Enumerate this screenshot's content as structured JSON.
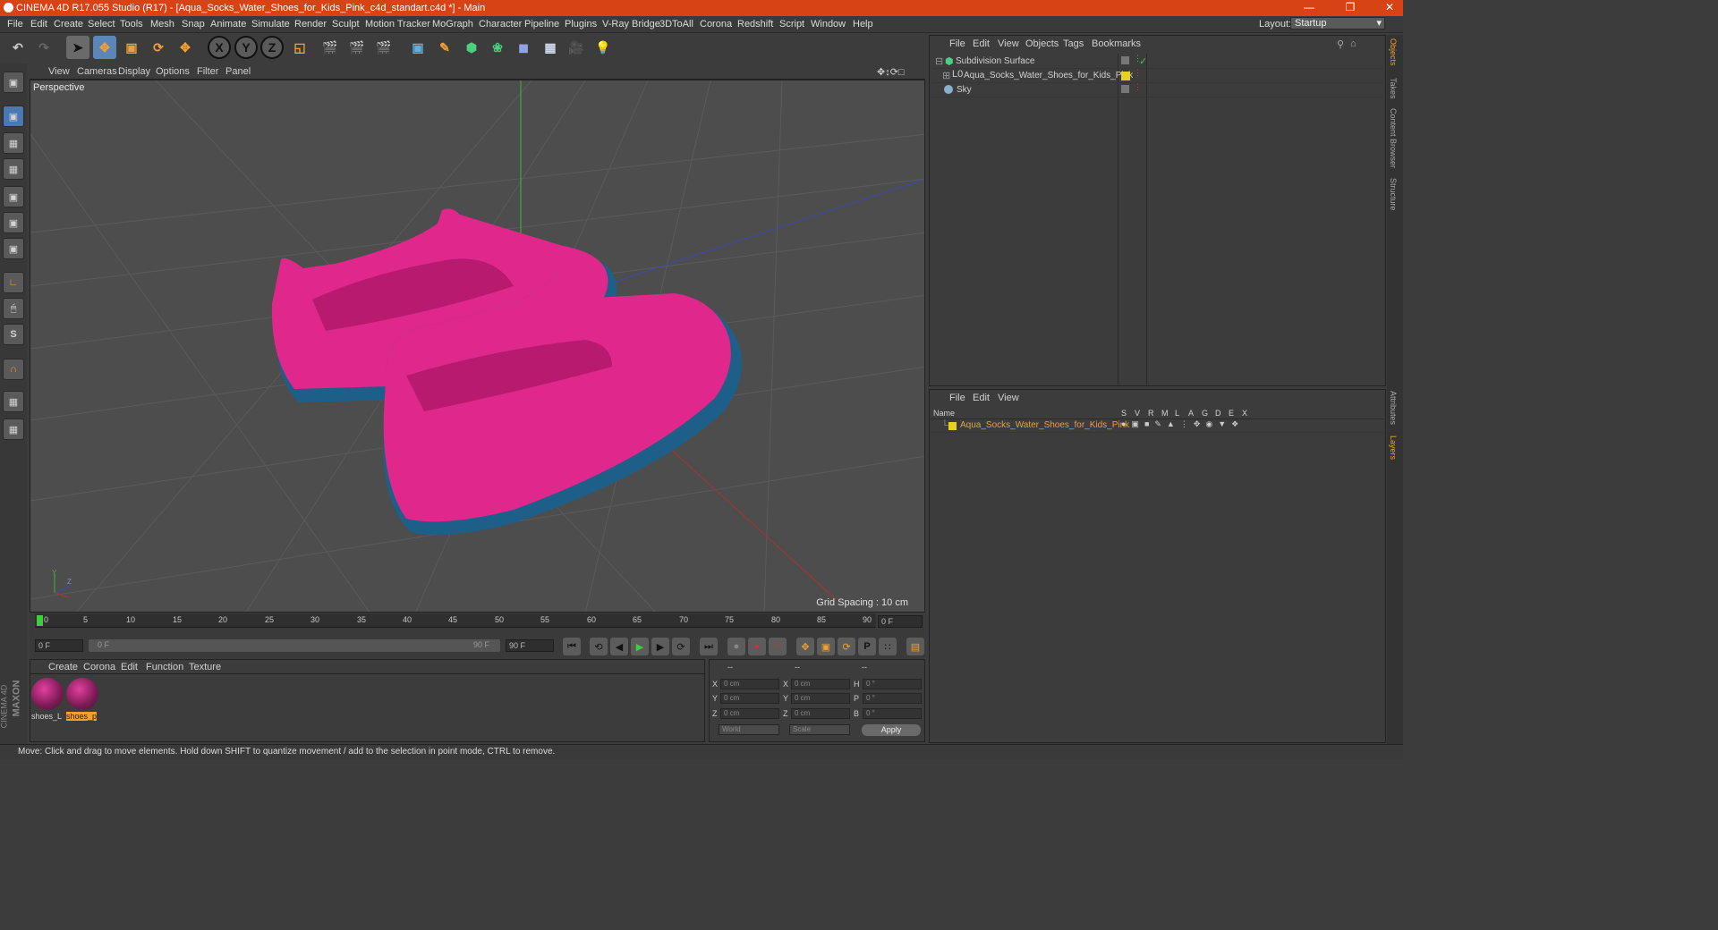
{
  "window": {
    "title": "CINEMA 4D R17.055 Studio (R17) - [Aqua_Socks_Water_Shoes_for_Kids_Pink_c4d_standart.c4d *] - Main",
    "minimize": "—",
    "restore": "❐",
    "close": "✕"
  },
  "menu": [
    "File",
    "Edit",
    "Create",
    "Select",
    "Tools",
    "Mesh",
    "Snap",
    "Animate",
    "Simulate",
    "Render",
    "Sculpt",
    "Motion Tracker",
    "MoGraph",
    "Character",
    "Pipeline",
    "Plugins",
    "V-Ray Bridge",
    "3DToAll",
    "Corona",
    "Redshift",
    "Script",
    "Window",
    "Help"
  ],
  "layout": {
    "label": "Layout:",
    "value": "Startup"
  },
  "toolbar": {
    "x": "X",
    "y": "Y",
    "z": "Z"
  },
  "viewport": {
    "menu": [
      "View",
      "Cameras",
      "Display",
      "Options",
      "Filter",
      "Panel"
    ],
    "label": "Perspective",
    "grid_spacing": "Grid Spacing : 10 cm",
    "axis_y": "Y",
    "axis_z": "Z"
  },
  "timeline": {
    "ticks": [
      "0",
      "5",
      "10",
      "15",
      "20",
      "25",
      "30",
      "35",
      "40",
      "45",
      "50",
      "55",
      "60",
      "65",
      "70",
      "75",
      "80",
      "85",
      "90"
    ],
    "current_frame": "0 F",
    "start": "0 F",
    "range_start": "0 F",
    "range_end": "90 F",
    "end": "90 F"
  },
  "materials": {
    "menu": [
      "Create",
      "Corona",
      "Edit",
      "Function",
      "Texture"
    ],
    "items": [
      {
        "label": "shoes_L"
      },
      {
        "label": "shoes_p"
      }
    ],
    "brand_line1": "MAXON",
    "brand_line2": "CINEMA 4D"
  },
  "coords": {
    "header": [
      "--",
      "--",
      "--"
    ],
    "rows": [
      {
        "a": "X",
        "av": "0 cm",
        "b": "X",
        "bv": "0 cm",
        "c": "H",
        "cv": "0 °"
      },
      {
        "a": "Y",
        "av": "0 cm",
        "b": "Y",
        "bv": "0 cm",
        "c": "P",
        "cv": "0 °"
      },
      {
        "a": "Z",
        "av": "0 cm",
        "b": "Z",
        "bv": "0 cm",
        "c": "B",
        "cv": "0 °"
      }
    ],
    "world": "World",
    "scale": "Scale",
    "apply": "Apply"
  },
  "status": "Move: Click and drag to move elements. Hold down SHIFT to quantize movement / add to the selection in point mode, CTRL to remove.",
  "objects": {
    "menu": [
      "File",
      "Edit",
      "View",
      "Objects",
      "Tags",
      "Bookmarks"
    ],
    "rows": [
      {
        "name": "Subdivision Surface"
      },
      {
        "name": "Aqua_Socks_Water_Shoes_for_Kids_Pink"
      },
      {
        "name": "Sky"
      }
    ]
  },
  "layers": {
    "menu": [
      "File",
      "Edit",
      "View"
    ],
    "col_name": "Name",
    "cols": [
      "S",
      "V",
      "R",
      "M",
      "L",
      "A",
      "G",
      "D",
      "E",
      "X"
    ],
    "row": "Aqua_Socks_Water_Shoes_for_Kids_Pink"
  },
  "sidetabs": [
    "Objects",
    "Takes",
    "Content Browser",
    "Structure",
    "Attributes",
    "Layers"
  ],
  "colors": {
    "title_bar": "#d84315",
    "shoe_pink": "#e0288c",
    "sole_blue": "#1e5f8a",
    "accent_orange": "#f0a030"
  }
}
